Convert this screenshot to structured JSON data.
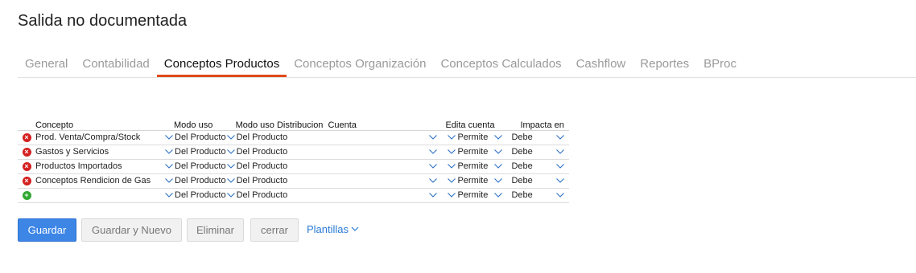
{
  "page": {
    "title": "Salida no documentada"
  },
  "tabs": [
    {
      "label": "General"
    },
    {
      "label": "Contabilidad"
    },
    {
      "label": "Conceptos Productos"
    },
    {
      "label": "Conceptos Organización"
    },
    {
      "label": "Conceptos Calculados"
    },
    {
      "label": "Cashflow"
    },
    {
      "label": "Reportes"
    },
    {
      "label": "BProc"
    }
  ],
  "active_tab": "Conceptos Productos",
  "table": {
    "headers": {
      "concepto": "Concepto",
      "modo_uso": "Modo uso",
      "modo_uso_distribucion": "Modo uso Distribucion",
      "cuenta": "Cuenta",
      "edita_cuenta": "Edita cuenta",
      "impacta_en": "Impacta en"
    },
    "rows": [
      {
        "action": "remove",
        "concepto": "Prod. Venta/Compra/Stock",
        "modo_uso": "Del Producto",
        "modo_uso_distribucion": "Del Producto",
        "cuenta": "",
        "edita_cuenta": "Permite",
        "impacta_en": "Debe"
      },
      {
        "action": "remove",
        "concepto": "Gastos y Servicios",
        "modo_uso": "Del Producto",
        "modo_uso_distribucion": "Del Producto",
        "cuenta": "",
        "edita_cuenta": "Permite",
        "impacta_en": "Debe"
      },
      {
        "action": "remove",
        "concepto": "Productos Importados",
        "modo_uso": "Del Producto",
        "modo_uso_distribucion": "Del Producto",
        "cuenta": "",
        "edita_cuenta": "Permite",
        "impacta_en": "Debe"
      },
      {
        "action": "remove",
        "concepto": "Conceptos Rendicion de Gas",
        "modo_uso": "Del Producto",
        "modo_uso_distribucion": "Del Producto",
        "cuenta": "",
        "edita_cuenta": "Permite",
        "impacta_en": "Debe"
      },
      {
        "action": "add",
        "concepto": "",
        "modo_uso": "Del Producto",
        "modo_uso_distribucion": "Del Producto",
        "cuenta": "",
        "edita_cuenta": "Permite",
        "impacta_en": "Debe"
      }
    ]
  },
  "buttons": {
    "guardar": "Guardar",
    "guardar_y_nuevo": "Guardar y Nuevo",
    "eliminar": "Eliminar",
    "cerrar": "cerrar",
    "plantillas": "Plantillas"
  },
  "icons": {
    "remove": "remove-circle-icon",
    "add": "add-circle-icon",
    "dropdown": "chevron-down-icon"
  },
  "colors": {
    "accent_tab": "#e04b1a",
    "primary_button": "#3d86e6",
    "link": "#2a7ad6",
    "remove_icon": "#d42020",
    "add_icon": "#2fa82f"
  }
}
